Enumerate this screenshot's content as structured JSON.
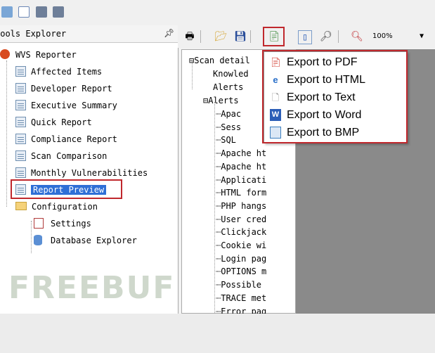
{
  "left_panel": {
    "title": "Tools Explorer",
    "pin_icon": "pin-icon",
    "root_label": "WVS Reporter",
    "reports": [
      "Affected Items",
      "Developer Report",
      "Executive Summary",
      "Quick Report",
      "Compliance Report",
      "Scan Comparison",
      "Monthly Vulnerabilities",
      "Report Preview"
    ],
    "config_label": "Configuration",
    "config_items": [
      "Settings",
      "Database Explorer"
    ]
  },
  "toolbar": {
    "zoom": "100%"
  },
  "doc_tree": {
    "root": "Scan detail",
    "children": [
      "Knowled",
      "Alerts",
      "Alerts"
    ],
    "alerts": [
      "Apac",
      "Sess",
      "SQL",
      "Apache ht",
      "Apache ht",
      "Applicati",
      "HTML form",
      "PHP hangs",
      "User cred",
      "Clickjack",
      "Cookie wi",
      "Login pag",
      "OPTIONS m",
      "Possible",
      "TRACE met",
      "Error pag"
    ]
  },
  "export_menu": {
    "items": [
      {
        "label": "Export to PDF",
        "icon": "pdf-icon",
        "color": "#d13b2f"
      },
      {
        "label": "Export to HTML",
        "icon": "html-icon",
        "color": "#2a6fc9"
      },
      {
        "label": "Export to Text",
        "icon": "text-file-icon",
        "color": "#888888"
      },
      {
        "label": "Export to Word",
        "icon": "word-icon",
        "color": "#2b5eb7"
      },
      {
        "label": "Export to BMP",
        "icon": "bmp-icon",
        "color": "#3c7fbf"
      }
    ]
  },
  "watermark": "FREEBUF",
  "colors": {
    "highlight": "#c0282d",
    "selection": "#2f6fd6"
  }
}
